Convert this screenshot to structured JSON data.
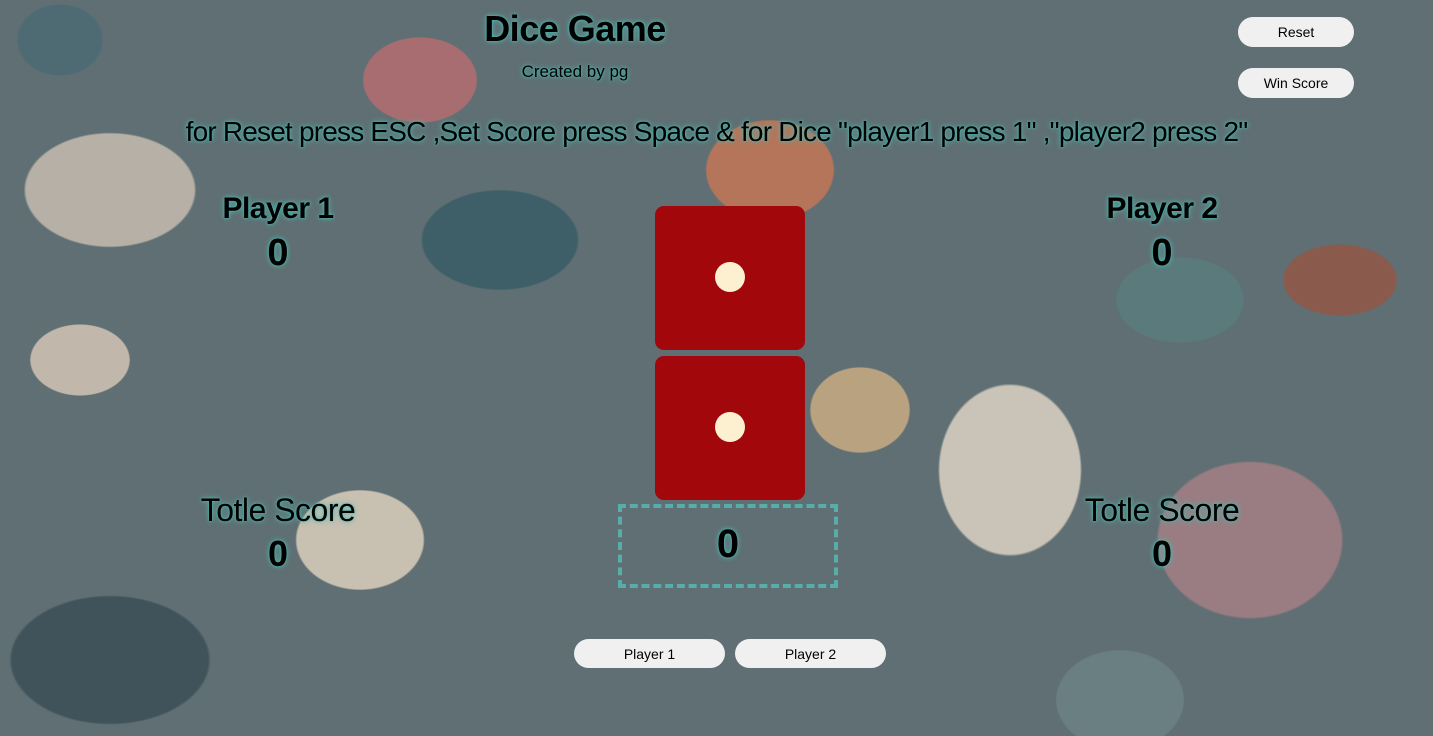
{
  "header": {
    "title": "Dice Game",
    "subtitle": "Created by pg",
    "instructions": "for Reset press ESC ,Set Score press Space & for Dice \"player1 press 1\" ,\"player2 press 2\""
  },
  "controls": {
    "reset_label": "Reset",
    "win_score_label": "Win Score",
    "player1_roll_label": "Player 1",
    "player2_roll_label": "Player 2"
  },
  "player1": {
    "name": "Player 1",
    "score": "0",
    "total_label": "Totle Score",
    "total": "0"
  },
  "player2": {
    "name": "Player 2",
    "score": "0",
    "total_label": "Totle Score",
    "total": "0"
  },
  "dice": {
    "die1_value": 1,
    "die2_value": 1,
    "die_color": "#a2070b",
    "pip_color": "#fdf0d0"
  },
  "round": {
    "value": "0",
    "border_color": "#56ada9"
  },
  "theme": {
    "glow_color": "#4fb9b2",
    "button_color": "#f0f0f0"
  }
}
